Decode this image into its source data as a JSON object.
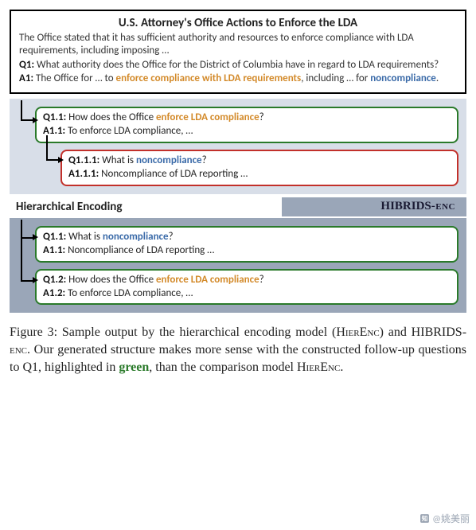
{
  "doc": {
    "title": "U.S. Attorney's Office Actions to Enforce the LDA",
    "body": "The Office stated that it has sufficient authority and resources to enforce compliance with LDA requirements, including imposing …",
    "q1_label": "Q1:",
    "q1_text": " What authority does the Office for the District of Columbia have in regard to LDA requirements?",
    "a1_label": "A1:",
    "a1_prefix": " The Office for … to ",
    "a1_hl1": "enforce compliance with LDA requirements",
    "a1_mid": ", including … for ",
    "a1_hl2": "noncompliance",
    "a1_suffix": "."
  },
  "hier": {
    "c1": {
      "q_label": "Q1.1:",
      "q_prefix": " How does the Office ",
      "q_hl": "enforce LDA compliance",
      "q_suffix": "?",
      "a_label": "A1.1:",
      "a_text": " To enforce LDA compliance, …"
    },
    "c2": {
      "q_label": "Q1.1.1:",
      "q_prefix": " What is ",
      "q_hl": "noncompliance",
      "q_suffix": "?",
      "a_label": "A1.1.1:",
      "a_text": " Noncompliance of LDA reporting …"
    }
  },
  "labels": {
    "left": "Hierarchical Encoding",
    "right_main": "HIBRIDS",
    "right_suffix": "-enc"
  },
  "hib": {
    "c1": {
      "q_label": "Q1.1:",
      "q_prefix": " What is ",
      "q_hl": "noncompliance",
      "q_suffix": "?",
      "a_label": "A1.1:",
      "a_text": " Noncompliance of LDA reporting …"
    },
    "c2": {
      "q_label": "Q1.2:",
      "q_prefix": " How does the Office ",
      "q_hl": "enforce LDA compliance",
      "q_suffix": "?",
      "a_label": "A1.2:",
      "a_text": " To enforce LDA compliance, …"
    }
  },
  "caption": {
    "fig_label": "Figure 3: ",
    "t1": "Sample output by the hierarchical encoding model (",
    "hierenc": "HierEnc",
    "t2": ") and HIBRIDS-",
    "enc": "enc",
    "t3": ". Our generated structure makes more sense with the constructed follow-up questions to Q1, highlighted in ",
    "green": "green",
    "t4": ", than the comparison model ",
    "hierenc2": "HierEnc",
    "t5": "."
  },
  "watermark": "@姚美丽"
}
